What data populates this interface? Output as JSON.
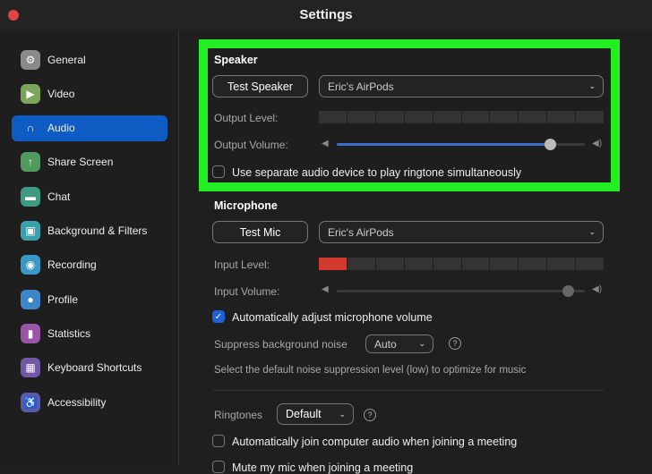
{
  "window": {
    "title": "Settings"
  },
  "sidebar": {
    "items": [
      {
        "label": "General",
        "icon": "gear-icon",
        "color": "#8a8a8a",
        "glyph": "⚙"
      },
      {
        "label": "Video",
        "icon": "video-camera-icon",
        "color": "#7aa55a",
        "glyph": "▶"
      },
      {
        "label": "Audio",
        "icon": "headphones-icon",
        "color": "#0e5bc4",
        "glyph": "∩",
        "active": true
      },
      {
        "label": "Share Screen",
        "icon": "share-screen-icon",
        "color": "#4f9a5c",
        "glyph": "↑"
      },
      {
        "label": "Chat",
        "icon": "chat-icon",
        "color": "#3f9a83",
        "glyph": "▬"
      },
      {
        "label": "Background & Filters",
        "icon": "background-icon",
        "color": "#3aa0aa",
        "glyph": "▣"
      },
      {
        "label": "Recording",
        "icon": "recording-icon",
        "color": "#3a98c4",
        "glyph": "◉"
      },
      {
        "label": "Profile",
        "icon": "profile-icon",
        "color": "#3f86c8",
        "glyph": "●"
      },
      {
        "label": "Statistics",
        "icon": "statistics-icon",
        "color": "#9b55a8",
        "glyph": "▮"
      },
      {
        "label": "Keyboard Shortcuts",
        "icon": "keyboard-icon",
        "color": "#7256a8",
        "glyph": "▦"
      },
      {
        "label": "Accessibility",
        "icon": "accessibility-icon",
        "color": "#5a5aa8",
        "glyph": "♿"
      }
    ]
  },
  "speaker": {
    "heading": "Speaker",
    "test_label": "Test Speaker",
    "device": "Eric's AirPods",
    "output_level_label": "Output Level:",
    "output_volume_label": "Output Volume:",
    "output_volume": 0.86,
    "separate_device_label": "Use separate audio device to play ringtone simultaneously",
    "separate_device_checked": false
  },
  "microphone": {
    "heading": "Microphone",
    "test_label": "Test Mic",
    "device": "Eric's AirPods",
    "input_level_label": "Input Level:",
    "input_level_segments": 1,
    "input_volume_label": "Input Volume:",
    "input_volume": 0.93,
    "auto_adjust_label": "Automatically adjust microphone volume",
    "auto_adjust_checked": true,
    "suppress_label": "Suppress background noise",
    "suppress_value": "Auto",
    "suppress_note": "Select the default noise suppression level (low) to optimize for music"
  },
  "ringtones": {
    "label": "Ringtones",
    "value": "Default"
  },
  "auto_join": {
    "label": "Automatically join computer audio when joining a meeting",
    "checked": false
  },
  "mute_join": {
    "label": "Mute my mic when joining a meeting",
    "checked": false
  },
  "colors": {
    "highlight": "#22ee22",
    "accent": "#0e5bc4",
    "level_red": "#d33a2f"
  }
}
